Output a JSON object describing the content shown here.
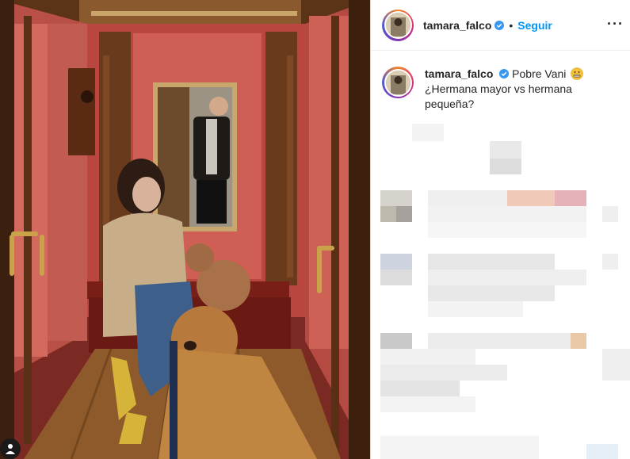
{
  "header": {
    "username": "tamara_falco",
    "separator": "•",
    "follow_label": "Seguir",
    "more_icon": "more-horizontal-icon"
  },
  "caption": {
    "username": "tamara_falco",
    "text_line1": "Pobre Vani",
    "text_line2": "¿Hermana mayor vs hermana pequeña?",
    "emoji": "grimacing-face-emoji"
  },
  "colors": {
    "link_blue": "#0095f6",
    "verified_blue": "#3897f0",
    "wall_red": "#c8544a",
    "wood": "#6a3a1c"
  },
  "comments": {
    "state": "pixelated / censored"
  }
}
